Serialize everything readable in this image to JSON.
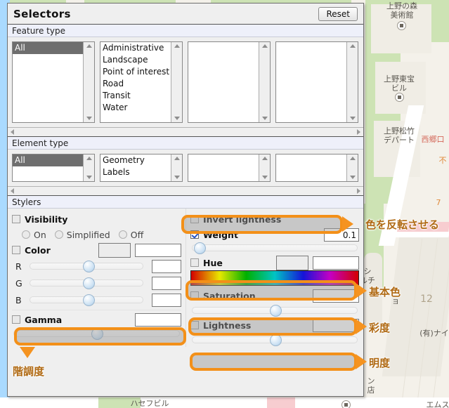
{
  "panel": {
    "title": "Selectors",
    "reset_label": "Reset",
    "sections": {
      "feature_type": {
        "header": "Feature type",
        "lists": [
          {
            "items": [
              "All"
            ],
            "selected": "All"
          },
          {
            "items": [
              "Administrative",
              "Landscape",
              "Point of interest",
              "Road",
              "Transit",
              "Water"
            ],
            "selected": ""
          },
          {
            "items": [],
            "selected": ""
          },
          {
            "items": [],
            "selected": ""
          }
        ]
      },
      "element_type": {
        "header": "Element type",
        "lists": [
          {
            "items": [
              "All"
            ],
            "selected": "All"
          },
          {
            "items": [
              "Geometry",
              "Labels"
            ],
            "selected": ""
          },
          {
            "items": [],
            "selected": ""
          },
          {
            "items": [],
            "selected": ""
          }
        ]
      },
      "stylers": {
        "header": "Stylers",
        "left": {
          "visibility": {
            "label": "Visibility",
            "checked": false
          },
          "visibility_options": [
            {
              "label": "On",
              "selected": false
            },
            {
              "label": "Simplified",
              "selected": false
            },
            {
              "label": "Off",
              "selected": false
            }
          ],
          "color": {
            "label": "Color",
            "checked": false,
            "swatch": "#ececec",
            "value": ""
          },
          "channels": [
            {
              "label": "R",
              "value": "",
              "knob_pct": 50
            },
            {
              "label": "G",
              "value": "",
              "knob_pct": 50
            },
            {
              "label": "B",
              "value": "",
              "knob_pct": 50
            }
          ],
          "gamma": {
            "label": "Gamma",
            "checked": false,
            "value": "",
            "knob_pct": 48
          }
        },
        "right": {
          "invert_lightness": {
            "label": "Invert lightness",
            "checked": false
          },
          "weight": {
            "label": "Weight",
            "checked": true,
            "value": "0.1",
            "knob_pct": 2
          },
          "hue": {
            "label": "Hue",
            "checked": false,
            "swatch": "#ececec",
            "value": ""
          },
          "saturation": {
            "label": "Saturation",
            "checked": false,
            "value": "",
            "knob_pct": 48
          },
          "lightness": {
            "label": "Lightness",
            "checked": false,
            "value": "",
            "knob_pct": 48
          }
        }
      }
    }
  },
  "annotations": [
    {
      "text": "色を反転させる",
      "meaning": "invert-lightness"
    },
    {
      "text": "基本色",
      "meaning": "hue"
    },
    {
      "text": "彩度",
      "meaning": "saturation"
    },
    {
      "text": "明度",
      "meaning": "lightness"
    },
    {
      "text": "階調度",
      "meaning": "gamma"
    }
  ],
  "map": {
    "labels": [
      {
        "text": "上野の森\n美術館"
      },
      {
        "text": "上野東宝\nビル"
      },
      {
        "text": "上野松竹\nデパート"
      },
      {
        "text": "西郷口"
      },
      {
        "text": "不"
      },
      {
        "text": "12"
      },
      {
        "text": "シ\nルチ"
      },
      {
        "text": "ョ"
      },
      {
        "text": "(有)ナイ"
      },
      {
        "text": "ン\n店"
      },
      {
        "text": "ハセフビル"
      },
      {
        "text": "エムス"
      },
      {
        "text": "7"
      }
    ]
  },
  "colors": {
    "highlight": "#f39019",
    "annotation_text": "#b06a14",
    "panel_bg": "#efefef",
    "section_bg": "#eef0fa",
    "selected_item": "#6e6e6e"
  }
}
